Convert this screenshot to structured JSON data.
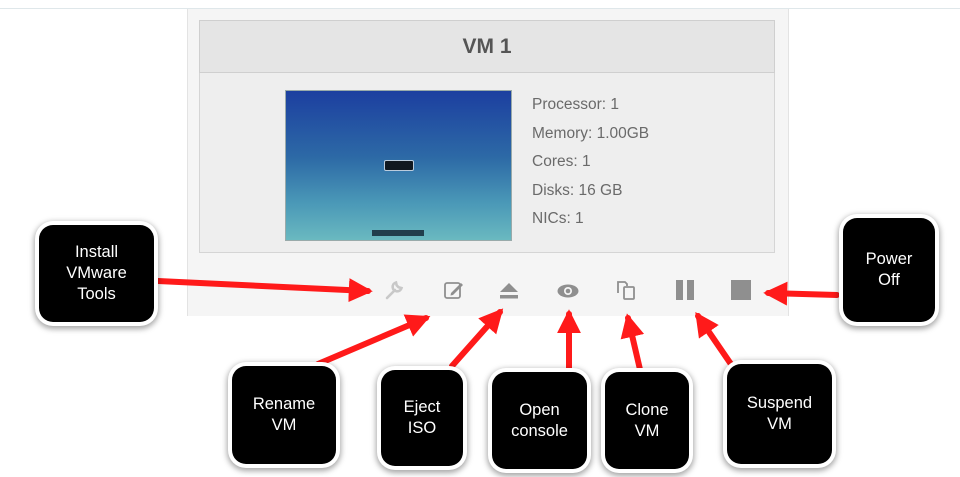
{
  "vm": {
    "title": "VM 1",
    "specs": [
      "Processor: 1",
      "Memory: 1.00GB",
      "Cores: 1",
      "Disks: 16 GB",
      "NICs: 1"
    ]
  },
  "toolbar_icons": [
    "wrench-icon",
    "edit-icon",
    "eject-icon",
    "eye-icon",
    "clone-icon",
    "pause-icon",
    "stop-icon"
  ],
  "callouts": {
    "install": "Install\nVMware\nTools",
    "power_off": "Power\nOff",
    "rename": "Rename\nVM",
    "eject": "Eject\nISO",
    "console": "Open\nconsole",
    "clone": "Clone\nVM",
    "suspend": "Suspend\nVM"
  },
  "colors": {
    "arrow": "#ff1a1a",
    "icon": "#8f8f8f",
    "icon_disabled": "#c8c8c8",
    "callout_bg": "#000000"
  }
}
